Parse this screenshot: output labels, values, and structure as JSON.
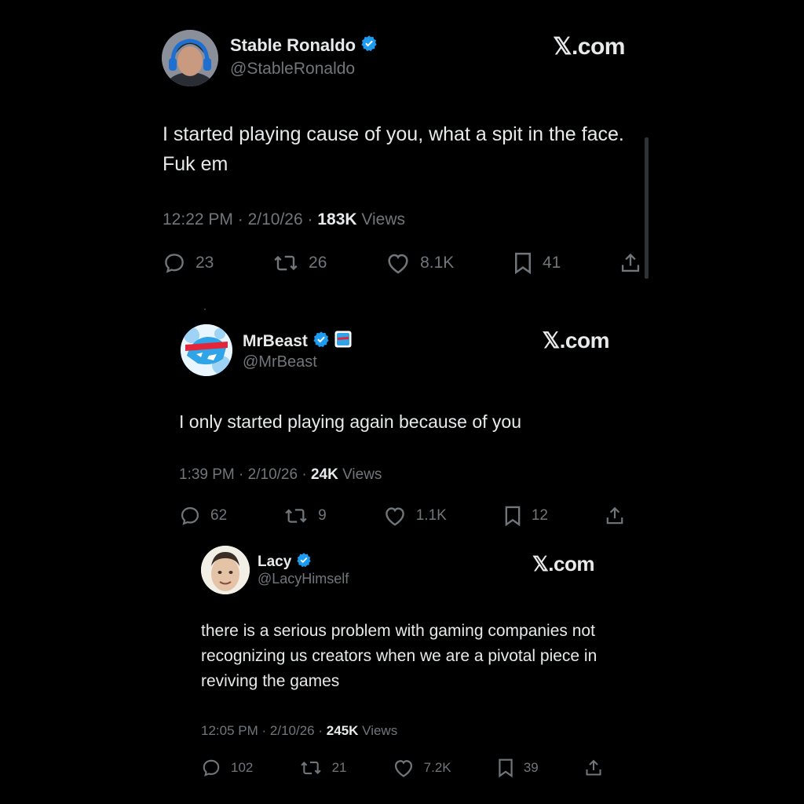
{
  "colors": {
    "background": "#000000",
    "text_primary": "#e7e9ea",
    "text_secondary": "#71767b",
    "verified": "#1d9bf0"
  },
  "tweets": [
    {
      "name": "Stable Ronaldo",
      "handle": "@StableRonaldo",
      "brand": "𝕏.com",
      "text": "I started playing cause of you, what a spit in the face. Fuk em",
      "time": "12:22 PM",
      "date": "2/10/26",
      "views_count": "183K",
      "views_label": "Views",
      "replies": "23",
      "reposts": "26",
      "likes": "8.1K",
      "bookmarks": "41",
      "verified": true,
      "avatar_icon": "gamer-headset-avatar"
    },
    {
      "name": "MrBeast",
      "handle": "@MrBeast",
      "brand": "𝕏.com",
      "text": "I only started playing again because of you",
      "time": "1:39 PM",
      "date": "2/10/26",
      "views_count": "24K",
      "views_label": "Views",
      "replies": "62",
      "reposts": "9",
      "likes": "1.1K",
      "bookmarks": "12",
      "verified": true,
      "avatar_icon": "beast-panther-logo"
    },
    {
      "name": "Lacy",
      "handle": "@LacyHimself",
      "brand": "𝕏.com",
      "text": "there is a serious problem with gaming companies not recognizing us creators when we are a pivotal piece in reviving the games",
      "time": "12:05 PM",
      "date": "2/10/26",
      "views_count": "245K",
      "views_label": "Views",
      "replies": "102",
      "reposts": "21",
      "likes": "7.2K",
      "bookmarks": "39",
      "verified": true,
      "avatar_icon": "person-avatar"
    }
  ],
  "separator": "·"
}
